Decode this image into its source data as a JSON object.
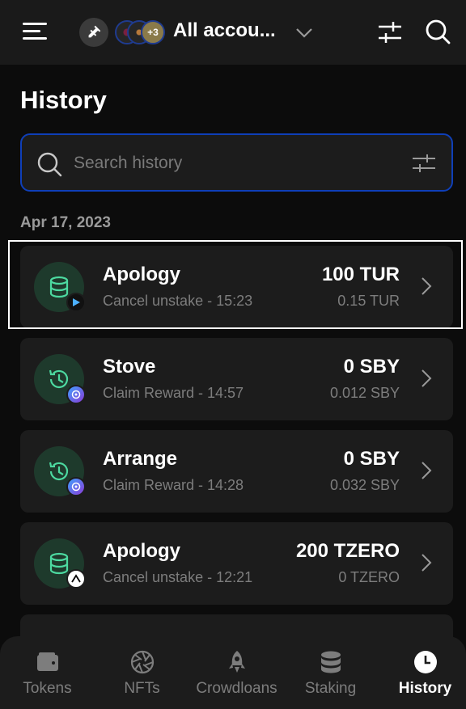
{
  "header": {
    "account_name": "All accou...",
    "more_accounts_badge": "+3",
    "icons": [
      "menu-icon",
      "plug-icon",
      "chevron-down-icon",
      "filter-icon",
      "search-icon"
    ]
  },
  "page": {
    "title": "History"
  },
  "search": {
    "placeholder": "Search history"
  },
  "date_group": "Apr 17, 2023",
  "items": [
    {
      "title": "Apology",
      "subtitle": "Cancel unstake - 15:23",
      "amount": "100 TUR",
      "fee": "0.15 TUR",
      "icon": "database-icon",
      "badge": "tur"
    },
    {
      "title": "Stove",
      "subtitle": "Claim Reward - 14:57",
      "amount": "0 SBY",
      "fee": "0.012 SBY",
      "icon": "history-icon",
      "badge": "sby"
    },
    {
      "title": "Arrange",
      "subtitle": "Claim Reward - 14:28",
      "amount": "0 SBY",
      "fee": "0.032 SBY",
      "icon": "history-icon",
      "badge": "sby"
    },
    {
      "title": "Apology",
      "subtitle": "Cancel unstake - 12:21",
      "amount": "200 TZERO",
      "fee": "0 TZERO",
      "icon": "database-icon",
      "badge": "tzero"
    }
  ],
  "nav": [
    {
      "label": "Tokens",
      "icon": "wallet-icon",
      "active": false
    },
    {
      "label": "NFTs",
      "icon": "aperture-icon",
      "active": false
    },
    {
      "label": "Crowdloans",
      "icon": "rocket-icon",
      "active": false
    },
    {
      "label": "Staking",
      "icon": "database-icon",
      "active": false
    },
    {
      "label": "History",
      "icon": "clock-icon",
      "active": true
    }
  ],
  "colors": {
    "background": "#0c0c0c",
    "surface": "#1c1c1c",
    "accent_green": "#4cd9a0",
    "focus_blue": "#0f3fb8",
    "muted_text": "#7d7d7d"
  }
}
